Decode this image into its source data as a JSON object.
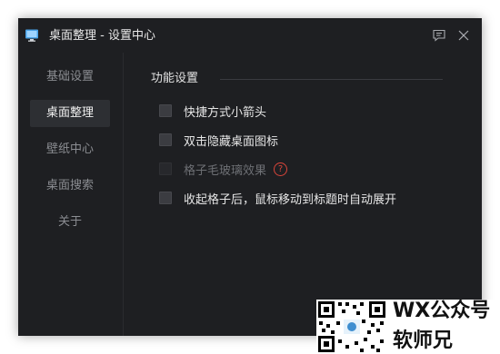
{
  "window": {
    "title": "桌面整理 - 设置中心"
  },
  "sidebar": {
    "items": [
      {
        "label": "基础设置",
        "active": false
      },
      {
        "label": "桌面整理",
        "active": true
      },
      {
        "label": "壁纸中心",
        "active": false
      },
      {
        "label": "桌面搜索",
        "active": false
      },
      {
        "label": "关于",
        "active": false
      }
    ]
  },
  "main": {
    "section_title": "功能设置",
    "options": [
      {
        "label": "快捷方式小箭头",
        "checked": false,
        "enabled": true
      },
      {
        "label": "双击隐藏桌面图标",
        "checked": false,
        "enabled": true
      },
      {
        "label": "格子毛玻璃效果",
        "checked": false,
        "enabled": false,
        "help": "?"
      },
      {
        "label": "收起格子后，鼠标移动到标题时自动展开",
        "checked": false,
        "enabled": true
      }
    ]
  },
  "watermark": {
    "line1": "WX公众号",
    "line2": "软师兄"
  },
  "colors": {
    "window_bg": "#1e1f22",
    "active_item_bg": "#2d2f33",
    "help_icon": "#d9453a"
  },
  "icons": {
    "app": "monitor-icon",
    "feedback": "feedback-icon",
    "close": "close-icon",
    "help": "question-circle-icon"
  }
}
